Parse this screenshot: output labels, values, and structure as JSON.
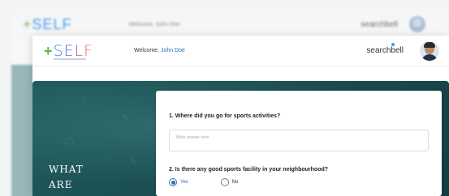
{
  "background_window": {
    "logo": "SELF",
    "welcome": "Welcome, John Doe",
    "brand": "searchbell"
  },
  "header": {
    "logo_text": "SELF",
    "welcome_prefix": "Welcome,",
    "user_name": "John Doe",
    "brand": "searchbell",
    "avatar_icon": "user-avatar-icon"
  },
  "panel": {
    "side_text_line1": "WHAT",
    "side_text_line2": "ARE"
  },
  "form": {
    "question1": "1. Where did you go for sports activities?",
    "answer1_placeholder": "Write answer here",
    "question2": "2. Is there any good sports facility in your neighbourhood?",
    "option_yes": "Yes",
    "option_no": "No",
    "selected": "Yes"
  },
  "colors": {
    "accent": "#2a6db5",
    "panel_teal": "#1b4d50",
    "logo_plus": "#6ab04c"
  }
}
